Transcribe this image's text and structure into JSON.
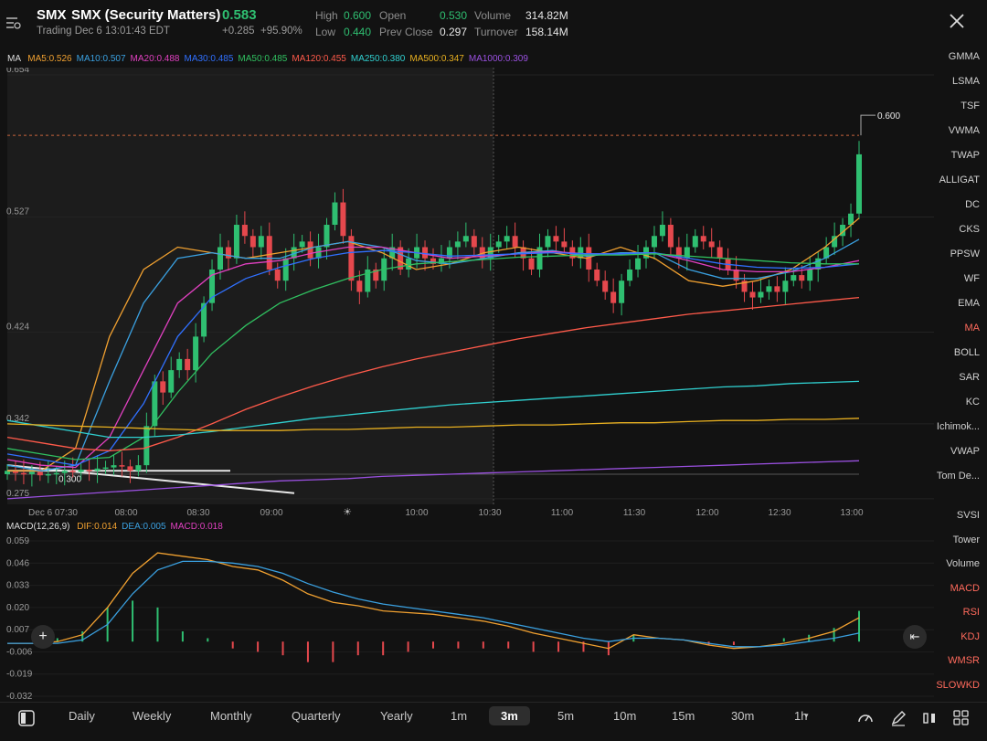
{
  "header": {
    "ticker": "SMX",
    "name": "SMX (Security Matters)",
    "price": "0.583",
    "change": "+0.285",
    "change_pct": "+95.90%",
    "status": "Trading Dec 6 13:01:43 EDT",
    "high_label": "High",
    "high": "0.600",
    "low_label": "Low",
    "low": "0.440",
    "open_label": "Open",
    "open": "0.530",
    "prev_close_label": "Prev Close",
    "prev_close": "0.297",
    "volume_label": "Volume",
    "volume": "314.82M",
    "turnover_label": "Turnover",
    "turnover": "158.14M"
  },
  "ma_legend": {
    "title": "MA",
    "items": [
      {
        "text": "MA5:0.526",
        "color": "#f0a030"
      },
      {
        "text": "MA10:0.507",
        "color": "#3aa0e0"
      },
      {
        "text": "MA20:0.488",
        "color": "#e040c0"
      },
      {
        "text": "MA30:0.485",
        "color": "#3070ff"
      },
      {
        "text": "MA50:0.485",
        "color": "#30c060"
      },
      {
        "text": "MA120:0.455",
        "color": "#ff5a4a"
      },
      {
        "text": "MA250:0.380",
        "color": "#30d0d0"
      },
      {
        "text": "MA500:0.347",
        "color": "#e8b020"
      },
      {
        "text": "MA1000:0.309",
        "color": "#9a50e0"
      }
    ]
  },
  "macd_legend": {
    "title": "MACD(12,26,9)",
    "items": [
      {
        "text": "DIF:0.014",
        "color": "#f0a030"
      },
      {
        "text": "DEA:0.005",
        "color": "#3aa0e0"
      },
      {
        "text": "MACD:0.018",
        "color": "#e040c0"
      }
    ]
  },
  "right_panel": {
    "overlays": [
      "GMMA",
      "LSMA",
      "TSF",
      "VWMA",
      "TWAP",
      "ALLIGAT",
      "DC",
      "CKS",
      "PPSW",
      "WF",
      "EMA",
      "MA",
      "BOLL",
      "SAR",
      "KC",
      "Ichimok...",
      "VWAP",
      "Tom De..."
    ],
    "active_overlay": "MA",
    "indicators": [
      "SVSI",
      "Tower",
      "Volume",
      "MACD",
      "RSI",
      "KDJ",
      "WMSR",
      "SLOWKD"
    ],
    "active_indicators": [
      "MACD",
      "RSI",
      "KDJ",
      "WMSR",
      "SLOWKD"
    ]
  },
  "timeframes": [
    "Daily",
    "Weekly",
    "Monthly",
    "Quarterly",
    "Yearly",
    "1m",
    "3m",
    "5m",
    "10m",
    "15m",
    "30m",
    "1h"
  ],
  "selected_timeframe": "3m",
  "annotations": {
    "high_marker": "0.600",
    "low_marker": "0.300"
  },
  "chart_data": [
    {
      "type": "candlestick",
      "title": "SMX 3m",
      "y_ticks": [
        "0.654",
        "0.527",
        "0.424",
        "0.342",
        "0.275"
      ],
      "x_ticks": [
        "Dec 6 07:30",
        "08:00",
        "08:30",
        "09:00",
        "10:00",
        "10:30",
        "11:00",
        "11:30",
        "12:00",
        "12:30",
        "13:00"
      ],
      "ylim": [
        0.27,
        0.654
      ],
      "reference_lines": [
        {
          "name": "High",
          "value": 0.6
        },
        {
          "name": "Prev Close",
          "value": 0.297
        }
      ],
      "series_close": [
        0.3,
        0.298,
        0.297,
        0.299,
        0.296,
        0.297,
        0.298,
        0.3,
        0.299,
        0.301,
        0.3,
        0.302,
        0.303,
        0.305,
        0.304,
        0.3,
        0.305,
        0.34,
        0.38,
        0.37,
        0.39,
        0.4,
        0.39,
        0.42,
        0.45,
        0.48,
        0.5,
        0.49,
        0.52,
        0.51,
        0.5,
        0.51,
        0.48,
        0.47,
        0.49,
        0.5,
        0.505,
        0.49,
        0.5,
        0.52,
        0.54,
        0.51,
        0.47,
        0.46,
        0.48,
        0.47,
        0.49,
        0.5,
        0.48,
        0.49,
        0.5,
        0.49,
        0.485,
        0.49,
        0.5,
        0.505,
        0.51,
        0.5,
        0.49,
        0.5,
        0.505,
        0.51,
        0.5,
        0.49,
        0.48,
        0.5,
        0.51,
        0.505,
        0.5,
        0.49,
        0.5,
        0.48,
        0.47,
        0.46,
        0.45,
        0.47,
        0.48,
        0.49,
        0.5,
        0.51,
        0.52,
        0.5,
        0.49,
        0.5,
        0.51,
        0.505,
        0.5,
        0.49,
        0.48,
        0.47,
        0.46,
        0.455,
        0.46,
        0.465,
        0.46,
        0.47,
        0.475,
        0.47,
        0.48,
        0.49,
        0.5,
        0.51,
        0.52,
        0.53,
        0.583
      ],
      "series": [
        {
          "name": "MA5",
          "values": [
            0.3,
            0.3,
            0.32,
            0.42,
            0.48,
            0.5,
            0.495,
            0.49,
            0.495,
            0.5,
            0.505,
            0.495,
            0.48,
            0.485,
            0.495,
            0.5,
            0.495,
            0.49,
            0.5,
            0.49,
            0.47,
            0.465,
            0.47,
            0.48,
            0.5,
            0.526
          ]
        },
        {
          "name": "MA10",
          "values": [
            0.305,
            0.3,
            0.305,
            0.38,
            0.45,
            0.49,
            0.495,
            0.49,
            0.49,
            0.5,
            0.505,
            0.5,
            0.488,
            0.485,
            0.49,
            0.495,
            0.497,
            0.492,
            0.495,
            0.495,
            0.48,
            0.472,
            0.472,
            0.478,
            0.49,
            0.507
          ]
        },
        {
          "name": "MA20",
          "values": [
            0.31,
            0.305,
            0.303,
            0.33,
            0.39,
            0.45,
            0.475,
            0.485,
            0.488,
            0.495,
            0.5,
            0.5,
            0.495,
            0.49,
            0.492,
            0.494,
            0.496,
            0.494,
            0.494,
            0.495,
            0.488,
            0.48,
            0.478,
            0.478,
            0.482,
            0.488
          ]
        },
        {
          "name": "MA30",
          "values": [
            0.315,
            0.31,
            0.305,
            0.318,
            0.36,
            0.42,
            0.455,
            0.472,
            0.482,
            0.49,
            0.495,
            0.497,
            0.495,
            0.492,
            0.493,
            0.494,
            0.495,
            0.494,
            0.494,
            0.495,
            0.49,
            0.485,
            0.482,
            0.481,
            0.482,
            0.485
          ]
        },
        {
          "name": "MA50",
          "values": [
            0.32,
            0.315,
            0.31,
            0.312,
            0.33,
            0.37,
            0.405,
            0.43,
            0.45,
            0.462,
            0.472,
            0.48,
            0.485,
            0.487,
            0.489,
            0.491,
            0.492,
            0.493,
            0.493,
            0.494,
            0.492,
            0.49,
            0.488,
            0.486,
            0.485,
            0.485
          ]
        },
        {
          "name": "MA120",
          "values": [
            0.33,
            0.325,
            0.32,
            0.318,
            0.32,
            0.33,
            0.342,
            0.355,
            0.366,
            0.376,
            0.385,
            0.393,
            0.4,
            0.406,
            0.412,
            0.418,
            0.423,
            0.428,
            0.432,
            0.436,
            0.44,
            0.443,
            0.446,
            0.449,
            0.452,
            0.455
          ]
        },
        {
          "name": "MA250",
          "values": [
            0.345,
            0.34,
            0.335,
            0.33,
            0.33,
            0.332,
            0.335,
            0.339,
            0.343,
            0.347,
            0.35,
            0.353,
            0.356,
            0.359,
            0.361,
            0.363,
            0.365,
            0.367,
            0.369,
            0.371,
            0.373,
            0.375,
            0.376,
            0.378,
            0.379,
            0.38
          ]
        },
        {
          "name": "MA500",
          "values": [
            0.342,
            0.341,
            0.34,
            0.339,
            0.338,
            0.337,
            0.336,
            0.336,
            0.336,
            0.337,
            0.337,
            0.338,
            0.339,
            0.339,
            0.34,
            0.341,
            0.341,
            0.342,
            0.343,
            0.343,
            0.344,
            0.345,
            0.345,
            0.346,
            0.346,
            0.347
          ]
        },
        {
          "name": "MA1000",
          "values": [
            0.275,
            0.277,
            0.279,
            0.281,
            0.283,
            0.285,
            0.287,
            0.289,
            0.291,
            0.292,
            0.293,
            0.295,
            0.296,
            0.297,
            0.298,
            0.299,
            0.3,
            0.301,
            0.302,
            0.303,
            0.304,
            0.305,
            0.306,
            0.307,
            0.308,
            0.309
          ]
        }
      ]
    },
    {
      "type": "bar",
      "title": "MACD(12,26,9)",
      "y_ticks": [
        "0.059",
        "0.046",
        "0.033",
        "0.020",
        "0.007",
        "-0.006",
        "-0.019",
        "-0.032"
      ],
      "ylim": [
        -0.032,
        0.059
      ],
      "series": [
        {
          "name": "DIF",
          "values": [
            -0.001,
            -0.001,
            0.0,
            0.004,
            0.02,
            0.04,
            0.052,
            0.05,
            0.048,
            0.044,
            0.042,
            0.036,
            0.028,
            0.023,
            0.021,
            0.018,
            0.017,
            0.016,
            0.014,
            0.012,
            0.009,
            0.005,
            0.002,
            -0.001,
            -0.004,
            0.004,
            0.002,
            0.001,
            -0.002,
            -0.004,
            -0.003,
            -0.001,
            0.002,
            0.006,
            0.014
          ]
        },
        {
          "name": "DEA",
          "values": [
            -0.001,
            -0.001,
            -0.001,
            0.001,
            0.01,
            0.028,
            0.042,
            0.047,
            0.047,
            0.046,
            0.044,
            0.04,
            0.034,
            0.029,
            0.025,
            0.022,
            0.02,
            0.018,
            0.016,
            0.014,
            0.011,
            0.008,
            0.005,
            0.002,
            0.0,
            0.002,
            0.002,
            0.001,
            -0.001,
            -0.003,
            -0.003,
            -0.002,
            0.0,
            0.002,
            0.005
          ]
        },
        {
          "name": "MACD",
          "values": [
            0.0,
            0.0,
            0.002,
            0.006,
            0.02,
            0.024,
            0.02,
            0.006,
            0.002,
            -0.004,
            -0.006,
            -0.008,
            -0.012,
            -0.012,
            -0.008,
            -0.008,
            -0.006,
            -0.004,
            -0.004,
            -0.004,
            -0.004,
            -0.006,
            -0.006,
            -0.006,
            -0.008,
            0.004,
            0.0,
            0.0,
            -0.002,
            -0.002,
            0.0,
            0.002,
            0.004,
            0.008,
            0.018
          ]
        }
      ]
    }
  ]
}
